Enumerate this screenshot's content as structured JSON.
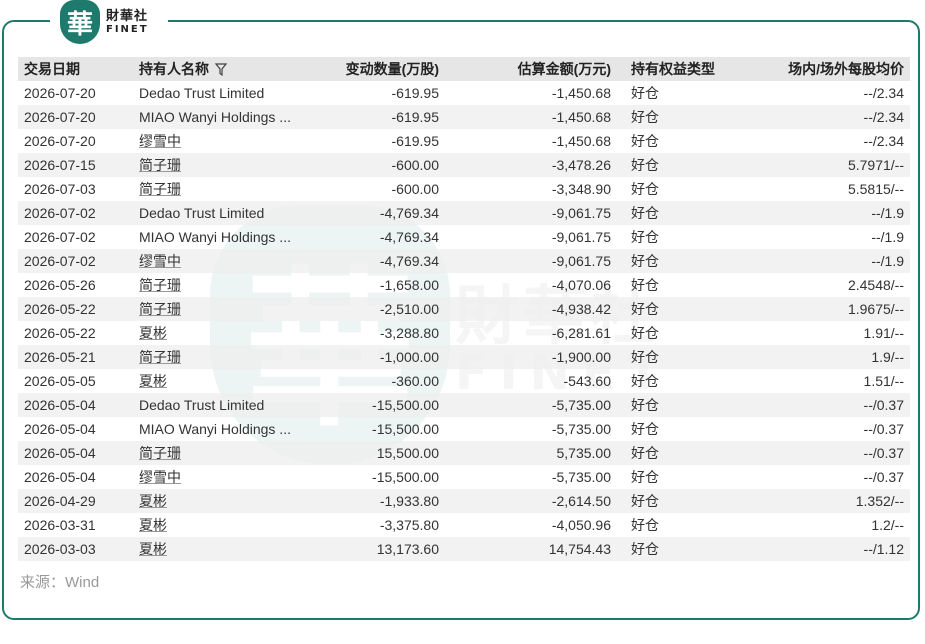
{
  "brand": {
    "badge_char": "華",
    "name_cn": "財華社",
    "name_en": "FINET"
  },
  "table": {
    "headers": {
      "date": "交易日期",
      "holder": "持有人名称",
      "change": "变动数量(万股)",
      "amount": "估算金额(万元)",
      "type": "持有权益类型",
      "price": "场内/场外每股均价"
    },
    "rows": [
      {
        "date": "2026-07-20",
        "holder": "Dedao Trust Limited",
        "change": "-619.95",
        "amount": "-1,450.68",
        "type": "好仓",
        "price": "--/2.34"
      },
      {
        "date": "2026-07-20",
        "holder": "MIAO Wanyi Holdings ...",
        "change": "-619.95",
        "amount": "-1,450.68",
        "type": "好仓",
        "price": "--/2.34"
      },
      {
        "date": "2026-07-20",
        "holder": "缪雪中",
        "change": "-619.95",
        "amount": "-1,450.68",
        "type": "好仓",
        "price": "--/2.34"
      },
      {
        "date": "2026-07-15",
        "holder": "简子珊",
        "change": "-600.00",
        "amount": "-3,478.26",
        "type": "好仓",
        "price": "5.7971/--"
      },
      {
        "date": "2026-07-03",
        "holder": "简子珊",
        "change": "-600.00",
        "amount": "-3,348.90",
        "type": "好仓",
        "price": "5.5815/--"
      },
      {
        "date": "2026-07-02",
        "holder": "Dedao Trust Limited",
        "change": "-4,769.34",
        "amount": "-9,061.75",
        "type": "好仓",
        "price": "--/1.9"
      },
      {
        "date": "2026-07-02",
        "holder": "MIAO Wanyi Holdings ...",
        "change": "-4,769.34",
        "amount": "-9,061.75",
        "type": "好仓",
        "price": "--/1.9"
      },
      {
        "date": "2026-07-02",
        "holder": "缪雪中",
        "change": "-4,769.34",
        "amount": "-9,061.75",
        "type": "好仓",
        "price": "--/1.9"
      },
      {
        "date": "2026-05-26",
        "holder": "简子珊",
        "change": "-1,658.00",
        "amount": "-4,070.06",
        "type": "好仓",
        "price": "2.4548/--"
      },
      {
        "date": "2026-05-22",
        "holder": "简子珊",
        "change": "-2,510.00",
        "amount": "-4,938.42",
        "type": "好仓",
        "price": "1.9675/--"
      },
      {
        "date": "2026-05-22",
        "holder": "夏彬",
        "change": "-3,288.80",
        "amount": "-6,281.61",
        "type": "好仓",
        "price": "1.91/--"
      },
      {
        "date": "2026-05-21",
        "holder": "简子珊",
        "change": "-1,000.00",
        "amount": "-1,900.00",
        "type": "好仓",
        "price": "1.9/--"
      },
      {
        "date": "2026-05-05",
        "holder": "夏彬",
        "change": "-360.00",
        "amount": "-543.60",
        "type": "好仓",
        "price": "1.51/--"
      },
      {
        "date": "2026-05-04",
        "holder": "Dedao Trust Limited",
        "change": "-15,500.00",
        "amount": "-5,735.00",
        "type": "好仓",
        "price": "--/0.37"
      },
      {
        "date": "2026-05-04",
        "holder": "MIAO Wanyi Holdings ...",
        "change": "-15,500.00",
        "amount": "-5,735.00",
        "type": "好仓",
        "price": "--/0.37"
      },
      {
        "date": "2026-05-04",
        "holder": "简子珊",
        "change": "15,500.00",
        "amount": "5,735.00",
        "type": "好仓",
        "price": "--/0.37"
      },
      {
        "date": "2026-05-04",
        "holder": "缪雪中",
        "change": "-15,500.00",
        "amount": "-5,735.00",
        "type": "好仓",
        "price": "--/0.37"
      },
      {
        "date": "2026-04-29",
        "holder": "夏彬",
        "change": "-1,933.80",
        "amount": "-2,614.50",
        "type": "好仓",
        "price": "1.352/--"
      },
      {
        "date": "2026-03-31",
        "holder": "夏彬",
        "change": "-3,375.80",
        "amount": "-4,050.96",
        "type": "好仓",
        "price": "1.2/--"
      },
      {
        "date": "2026-03-03",
        "holder": "夏彬",
        "change": "13,173.60",
        "amount": "14,754.43",
        "type": "好仓",
        "price": "--/1.12"
      }
    ]
  },
  "source": "来源：Wind",
  "colors": {
    "brand_green": "#1d7a6c",
    "header_bg": "#e6e6e6"
  }
}
